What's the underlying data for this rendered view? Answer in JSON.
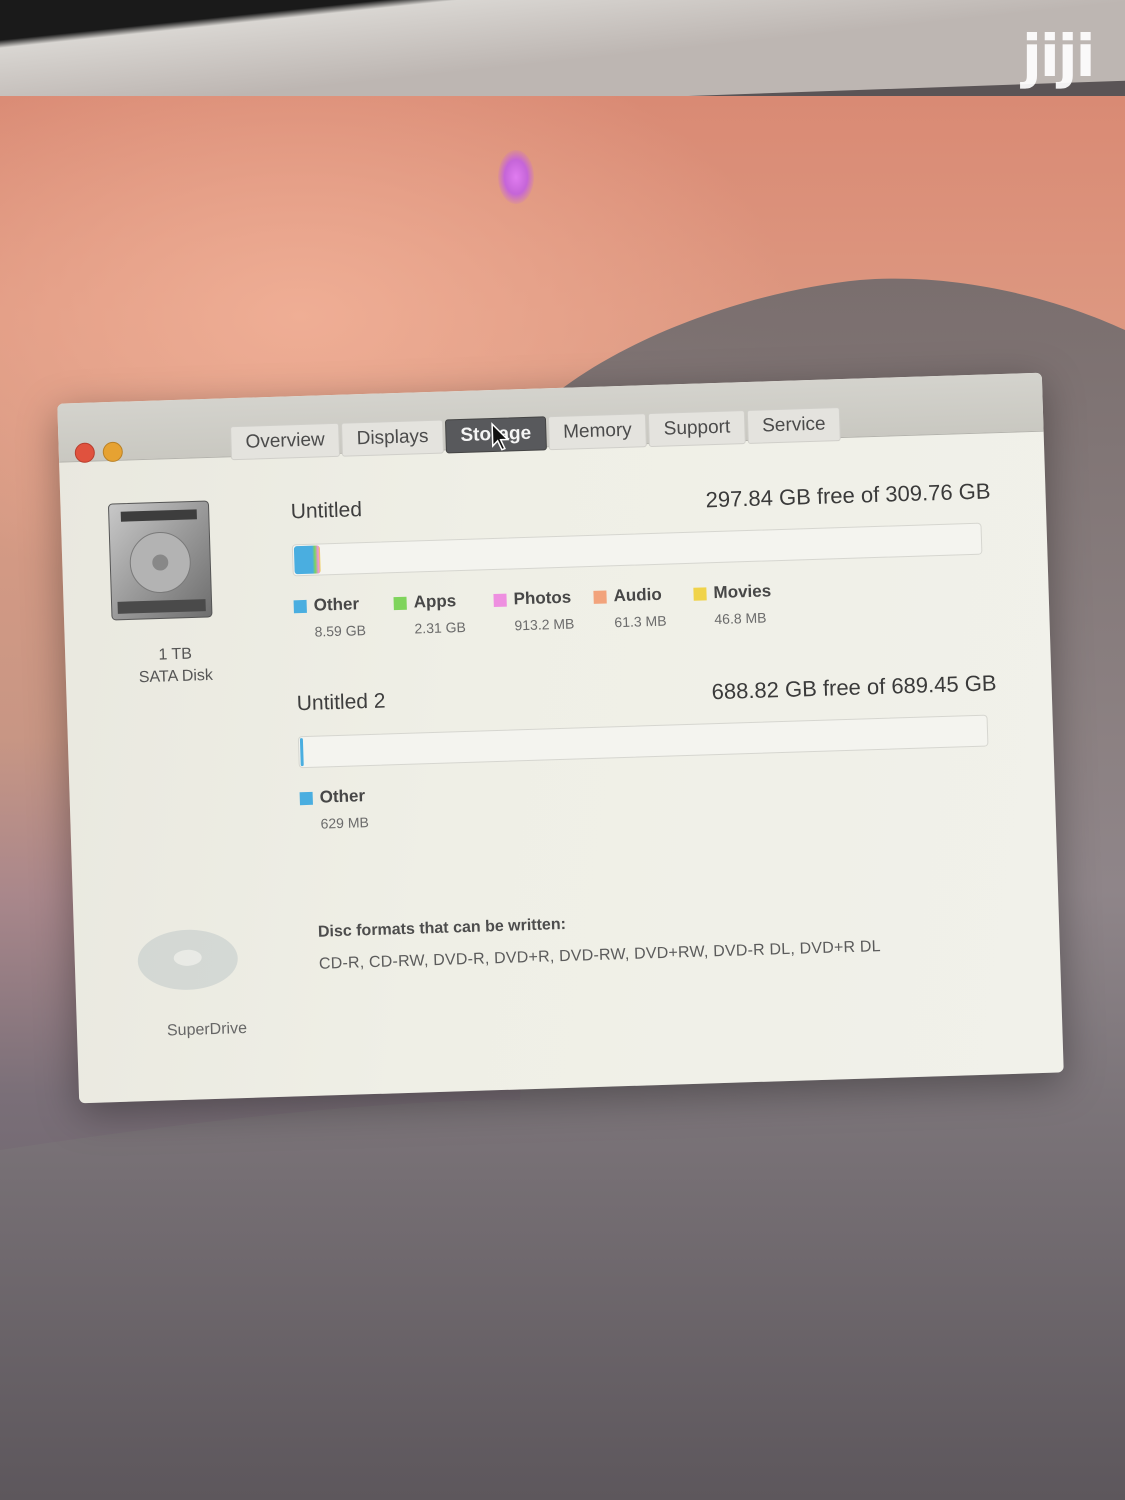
{
  "watermark": "jiji",
  "window": {
    "tabs": [
      {
        "label": "Overview",
        "active": false
      },
      {
        "label": "Displays",
        "active": false
      },
      {
        "label": "Storage",
        "active": true
      },
      {
        "label": "Memory",
        "active": false
      },
      {
        "label": "Support",
        "active": false
      },
      {
        "label": "Service",
        "active": false
      }
    ]
  },
  "disk": {
    "capacity": "1 TB",
    "type": "SATA Disk"
  },
  "optical": {
    "name": "SuperDrive"
  },
  "volumes": [
    {
      "name": "Untitled",
      "free_text": "297.84 GB free of 309.76 GB",
      "used_fraction": 0.0385,
      "legend": [
        {
          "label": "Other",
          "size": "8.59 GB",
          "color": "#4aaee0"
        },
        {
          "label": "Apps",
          "size": "2.31 GB",
          "color": "#7fd45c"
        },
        {
          "label": "Photos",
          "size": "913.2 MB",
          "color": "#ee8fe0"
        },
        {
          "label": "Audio",
          "size": "61.3 MB",
          "color": "#f2a37c"
        },
        {
          "label": "Movies",
          "size": "46.8 MB",
          "color": "#f0d34a"
        }
      ]
    },
    {
      "name": "Untitled 2",
      "free_text": "688.82 GB free of 689.45 GB",
      "used_fraction": 0.0009,
      "legend": [
        {
          "label": "Other",
          "size": "629 MB",
          "color": "#4aaee0"
        }
      ]
    }
  ],
  "disc": {
    "title": "Disc formats that can be written:",
    "formats": "CD-R, CD-RW, DVD-R, DVD+R, DVD-RW, DVD+RW, DVD-R DL, DVD+R DL"
  }
}
